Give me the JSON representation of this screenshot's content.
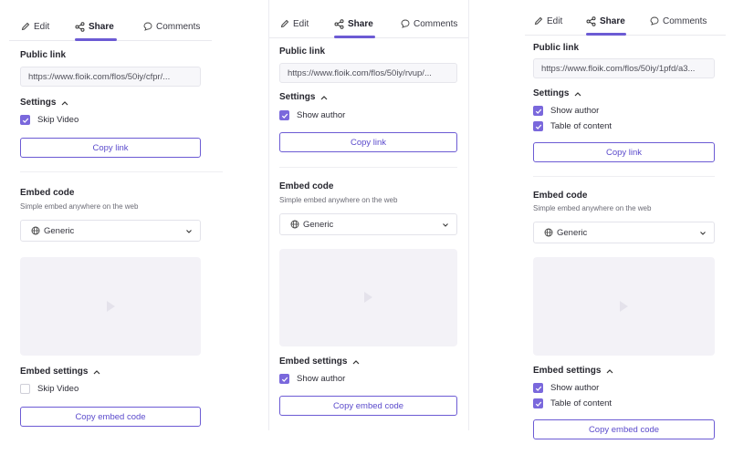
{
  "panels": [
    {
      "tabs": {
        "edit": "Edit",
        "share": "Share",
        "comments": "Comments"
      },
      "public_link": {
        "label": "Public link",
        "value": "https://www.floik.com/flos/50iy/cfpr/..."
      },
      "settings": {
        "label": "Settings",
        "options": [
          {
            "label": "Skip Video",
            "checked": true
          }
        ]
      },
      "copy_link": "Copy link",
      "embed": {
        "label": "Embed code",
        "subtitle": "Simple embed anywhere on the web",
        "select_value": "Generic"
      },
      "embed_settings": {
        "label": "Embed settings",
        "options": [
          {
            "label": "Skip Video",
            "checked": false
          }
        ]
      },
      "copy_embed": "Copy embed code"
    },
    {
      "tabs": {
        "edit": "Edit",
        "share": "Share",
        "comments": "Comments"
      },
      "public_link": {
        "label": "Public link",
        "value": "https://www.floik.com/flos/50iy/rvup/..."
      },
      "settings": {
        "label": "Settings",
        "options": [
          {
            "label": "Show author",
            "checked": true
          }
        ]
      },
      "copy_link": "Copy link",
      "embed": {
        "label": "Embed code",
        "subtitle": "Simple embed anywhere on the web",
        "select_value": "Generic"
      },
      "embed_settings": {
        "label": "Embed settings",
        "options": [
          {
            "label": "Show author",
            "checked": true
          }
        ]
      },
      "copy_embed": "Copy embed code"
    },
    {
      "tabs": {
        "edit": "Edit",
        "share": "Share",
        "comments": "Comments"
      },
      "public_link": {
        "label": "Public link",
        "value": "https://www.floik.com/flos/50iy/1pfd/a3..."
      },
      "settings": {
        "label": "Settings",
        "options": [
          {
            "label": "Show author",
            "checked": true
          },
          {
            "label": "Table of content",
            "checked": true
          }
        ]
      },
      "copy_link": "Copy link",
      "embed": {
        "label": "Embed code",
        "subtitle": "Simple embed anywhere on the web",
        "select_value": "Generic"
      },
      "embed_settings": {
        "label": "Embed settings",
        "options": [
          {
            "label": "Show author",
            "checked": true
          },
          {
            "label": "Table of content",
            "checked": true
          }
        ]
      },
      "copy_embed": "Copy embed code"
    }
  ],
  "colors": {
    "accent": "#6c5bd4",
    "checkbox": "#7a68dc",
    "preview_bg": "#f3f2f7"
  }
}
